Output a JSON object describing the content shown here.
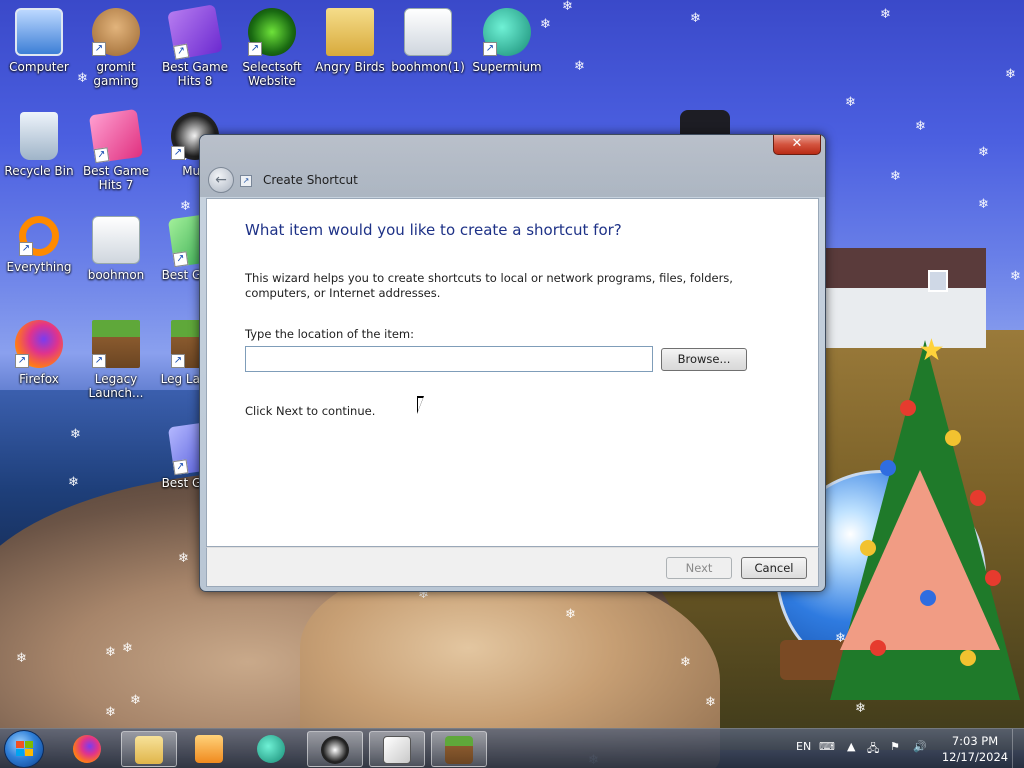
{
  "desktop": {
    "icons": [
      {
        "label": "Computer",
        "icon": "computer-icon"
      },
      {
        "label": "gromit gaming",
        "icon": "gromit-icon"
      },
      {
        "label": "Best Game Hits 8",
        "icon": "dice-icon"
      },
      {
        "label": "Selectsoft Website",
        "icon": "selectsoft-icon"
      },
      {
        "label": "Angry Birds",
        "icon": "folder-icon"
      },
      {
        "label": "boohmon(1)",
        "icon": "gear-file-icon"
      },
      {
        "label": "Supermium",
        "icon": "supermium-icon"
      },
      {
        "label": "Recycle Bin",
        "icon": "recycle-bin-icon"
      },
      {
        "label": "Best Game Hits 7",
        "icon": "dice-icon"
      },
      {
        "label": "Mun",
        "icon": "ble-icon"
      },
      {
        "label": "Everything",
        "icon": "everything-icon"
      },
      {
        "label": "boohmon",
        "icon": "gear-file-icon"
      },
      {
        "label": "Best G Hits",
        "icon": "dice-icon"
      },
      {
        "label": "Firefox",
        "icon": "firefox-icon"
      },
      {
        "label": "Legacy Launch...",
        "icon": "minecraft-icon"
      },
      {
        "label": "Leg Launch",
        "icon": "minecraft-icon"
      },
      {
        "label": "Best G Hits",
        "icon": "dice-icon"
      }
    ]
  },
  "dialog": {
    "close_label": "✕",
    "title": "Create Shortcut",
    "heading": "What item would you like to create a shortcut for?",
    "description": "This wizard helps you to create shortcuts to local or network programs, files, folders, computers, or Internet addresses.",
    "location_label": "Type the location of the item:",
    "location_value": "",
    "location_placeholder": "",
    "browse_label": "Browse...",
    "continue_text": "Click Next to continue.",
    "next_label": "Next",
    "cancel_label": "Cancel"
  },
  "taskbar": {
    "apps": [
      {
        "name": "firefox-icon"
      },
      {
        "name": "explorer-icon",
        "active": true
      },
      {
        "name": "media-player-icon"
      },
      {
        "name": "supermium-icon"
      },
      {
        "name": "ble-icon"
      },
      {
        "name": "solitaire-icon"
      },
      {
        "name": "minecraft-icon"
      }
    ],
    "language": "EN",
    "time": "7:03 PM",
    "date": "12/17/2024"
  }
}
